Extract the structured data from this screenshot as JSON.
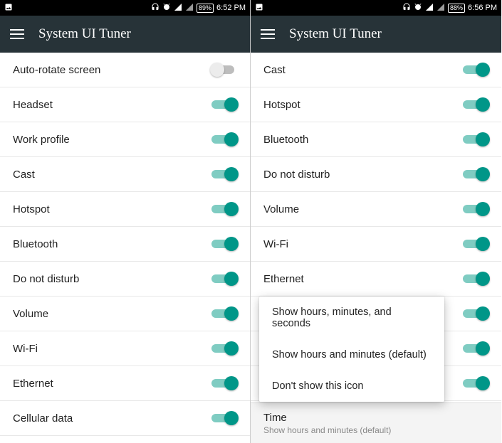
{
  "left": {
    "status": {
      "battery": "89%",
      "time": "6:52 PM"
    },
    "title": "System UI Tuner",
    "items": [
      {
        "label": "Auto-rotate screen",
        "on": false
      },
      {
        "label": "Headset",
        "on": true
      },
      {
        "label": "Work profile",
        "on": true
      },
      {
        "label": "Cast",
        "on": true
      },
      {
        "label": "Hotspot",
        "on": true
      },
      {
        "label": "Bluetooth",
        "on": true
      },
      {
        "label": "Do not disturb",
        "on": true
      },
      {
        "label": "Volume",
        "on": true
      },
      {
        "label": "Wi-Fi",
        "on": true
      },
      {
        "label": "Ethernet",
        "on": true
      },
      {
        "label": "Cellular data",
        "on": true
      }
    ]
  },
  "right": {
    "status": {
      "battery": "88%",
      "time": "6:56 PM"
    },
    "title": "System UI Tuner",
    "items": [
      {
        "label": "Cast",
        "on": true
      },
      {
        "label": "Hotspot",
        "on": true
      },
      {
        "label": "Bluetooth",
        "on": true
      },
      {
        "label": "Do not disturb",
        "on": true
      },
      {
        "label": "Volume",
        "on": true
      },
      {
        "label": "Wi-Fi",
        "on": true
      },
      {
        "label": "Ethernet",
        "on": true
      },
      {
        "label": "",
        "on": true
      },
      {
        "label": "",
        "on": true
      },
      {
        "label": "",
        "on": true
      }
    ],
    "popup": {
      "options": [
        "Show hours, minutes, and seconds",
        "Show hours and minutes (default)",
        "Don't show this icon"
      ]
    },
    "time_section": {
      "title": "Time",
      "subtitle": "Show hours and minutes (default)"
    }
  }
}
